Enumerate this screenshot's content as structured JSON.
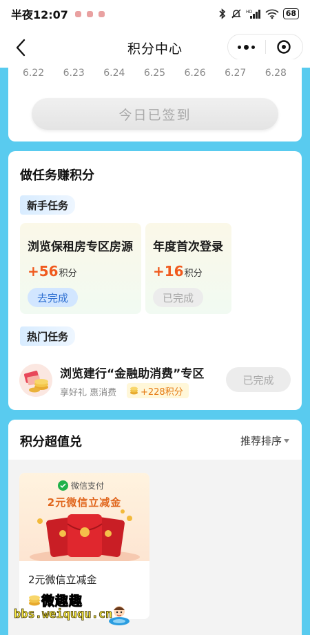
{
  "status_bar": {
    "time": "半夜12:07",
    "battery": "68"
  },
  "nav": {
    "title": "积分中心"
  },
  "signin": {
    "dates": [
      "6.22",
      "6.23",
      "6.24",
      "6.25",
      "6.26",
      "6.27",
      "6.28"
    ],
    "button_label": "今日已签到"
  },
  "tasks": {
    "title": "做任务赚积分",
    "newbie_tag": "新手任务",
    "newbie": [
      {
        "name": "浏览保租房专区房源",
        "points": "+56",
        "unit": "积分",
        "button": "去完成"
      },
      {
        "name": "年度首次登录",
        "points": "+16",
        "unit": "积分",
        "button": "已完成"
      }
    ],
    "hot_tag": "热门任务",
    "hot": {
      "title": "浏览建行“金融助消费”专区",
      "subtitle": "享好礼 惠消费",
      "points": "+228积分",
      "button": "已完成"
    }
  },
  "exchange": {
    "title": "积分超值兑",
    "sort_label": "推荐排序",
    "products": [
      {
        "banner_brand": "微信支付",
        "banner_title": "2元微信立减金",
        "name": "2元微信立减金"
      }
    ]
  },
  "watermark": {
    "site_name": "微趣趣",
    "url": "bbs.weiququ.cn"
  },
  "colors": {
    "page_bg": "#59cbef",
    "accent_orange": "#f05a1e",
    "go_button_bg": "#d2e6ff",
    "go_button_text": "#2d6fd1"
  }
}
